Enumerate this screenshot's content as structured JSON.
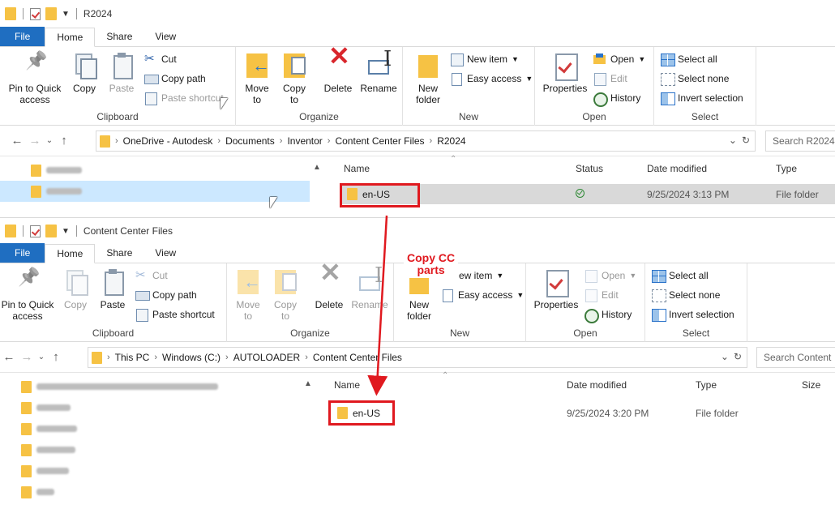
{
  "window1": {
    "title": "R2024",
    "tabs": [
      "File",
      "Home",
      "Share",
      "View"
    ],
    "ribbon": {
      "clipboard": {
        "pin": "Pin to Quick access",
        "copy": "Copy",
        "paste": "Paste",
        "cut": "Cut",
        "copy_path": "Copy path",
        "paste_shortcut": "Paste shortcut",
        "label": "Clipboard"
      },
      "organize": {
        "move_to": "Move to",
        "copy_to": "Copy to",
        "delete": "Delete",
        "rename": "Rename",
        "label": "Organize"
      },
      "new": {
        "new_folder": "New folder",
        "new_item": "New item",
        "easy_access": "Easy access",
        "label": "New"
      },
      "open": {
        "properties": "Properties",
        "open": "Open",
        "edit": "Edit",
        "history": "History",
        "label": "Open"
      },
      "select": {
        "select_all": "Select all",
        "select_none": "Select none",
        "invert": "Invert selection",
        "label": "Select"
      }
    },
    "address": [
      "OneDrive - Autodesk",
      "Documents",
      "Inventor",
      "Content Center Files",
      "R2024"
    ],
    "search_placeholder": "Search R2024",
    "columns": {
      "name": "Name",
      "status": "Status",
      "date": "Date modified",
      "type": "Type"
    },
    "files": [
      {
        "name": "en-US",
        "date": "9/25/2024 3:13 PM",
        "type": "File folder"
      }
    ]
  },
  "window2": {
    "title": "Content Center Files",
    "tabs": [
      "File",
      "Home",
      "Share",
      "View"
    ],
    "ribbon": {
      "clipboard": {
        "pin": "Pin to Quick access",
        "copy": "Copy",
        "paste": "Paste",
        "cut": "Cut",
        "copy_path": "Copy path",
        "paste_shortcut": "Paste shortcut",
        "label": "Clipboard"
      },
      "organize": {
        "move_to": "Move to",
        "copy_to": "Copy to",
        "delete": "Delete",
        "rename": "Rename",
        "label": "Organize"
      },
      "new": {
        "new_folder": "New folder",
        "new_item": "ew item",
        "easy_access": "Easy access",
        "label": "New"
      },
      "open": {
        "properties": "Properties",
        "open": "Open",
        "edit": "Edit",
        "history": "History",
        "label": "Open"
      },
      "select": {
        "select_all": "Select all",
        "select_none": "Select none",
        "invert": "Invert selection",
        "label": "Select"
      }
    },
    "address": [
      "This PC",
      "Windows (C:)",
      "AUTOLOADER",
      "Content Center Files"
    ],
    "search_placeholder": "Search Content",
    "columns": {
      "name": "Name",
      "date": "Date modified",
      "type": "Type",
      "size": "Size"
    },
    "files": [
      {
        "name": "en-US",
        "date": "9/25/2024 3:20 PM",
        "type": "File folder"
      }
    ]
  },
  "annotation": {
    "text_line1": "Copy CC",
    "text_line2": "parts",
    "color": "#e0191f"
  },
  "colors": {
    "file_tab": "#1f6ec1",
    "folder": "#f6c244",
    "highlight_box": "#e0191f"
  }
}
